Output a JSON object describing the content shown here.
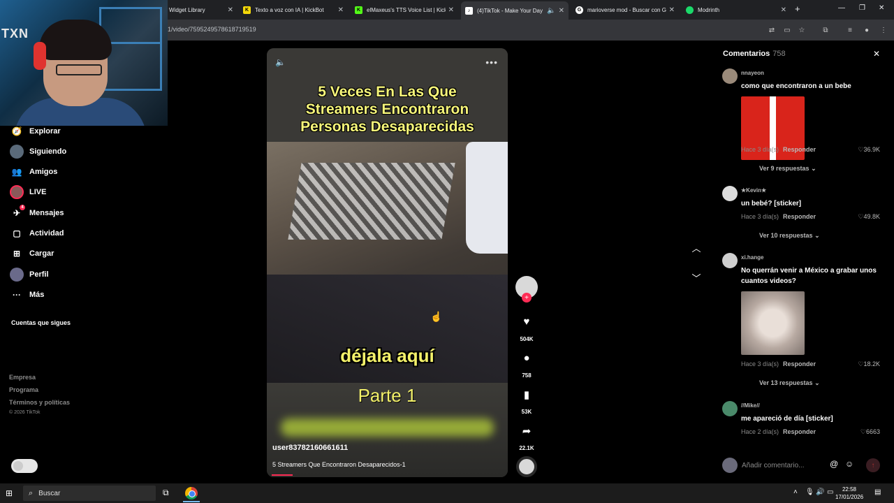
{
  "browser": {
    "tabs": [
      {
        "label": "Widget Library",
        "favicon_color": "#202124"
      },
      {
        "label": "Texto a voz con IA | KickBot",
        "favicon_color": "#f5d90a"
      },
      {
        "label": "elMaxeus's TTS Voice List | Kick",
        "favicon_color": "#53fc18"
      },
      {
        "label": "(4)TikTok - Make Your Day",
        "favicon_color": "#ffffff"
      },
      {
        "label": "marioverse mod - Buscar con G",
        "favicon_color": "#ffffff"
      },
      {
        "label": "Modrinth",
        "favicon_color": "#1bd96a"
      }
    ],
    "url": "1/video/7595249578618719519"
  },
  "webcam": {
    "logo_text": "TXN"
  },
  "sidebar": {
    "items": [
      {
        "label": "Explorar",
        "icon": "compass-icon"
      },
      {
        "label": "Siguiendo",
        "icon": "following-avatar-icon"
      },
      {
        "label": "Amigos",
        "icon": "friends-icon"
      },
      {
        "label": "LIVE",
        "icon": "live-avatar-icon"
      },
      {
        "label": "Mensajes",
        "icon": "messages-icon",
        "badge": "4"
      },
      {
        "label": "Actividad",
        "icon": "activity-icon"
      },
      {
        "label": "Cargar",
        "icon": "upload-icon"
      },
      {
        "label": "Perfil",
        "icon": "profile-avatar-icon"
      },
      {
        "label": "Más",
        "icon": "more-dots-icon"
      }
    ],
    "following_title": "Cuentas que sigues",
    "footer_links": [
      "Empresa",
      "Programa",
      "Términos y políticas"
    ],
    "copyright": "© 2026 TikTok"
  },
  "video": {
    "title_lines": [
      "5 Veces En Las Que",
      "Streamers Encontraron",
      "Personas Desaparecidas"
    ],
    "caption": "déjala aquí",
    "part": "Parte 1",
    "username": "user83782160661611",
    "description": "5 Streamers Que Encontraron Desaparecidos-1"
  },
  "actions": {
    "likes": "504K",
    "comments": "758",
    "saves": "53K",
    "shares": "22.1K"
  },
  "comments": {
    "title": "Comentarios",
    "count": "758",
    "reply_label": "Responder",
    "input_placeholder": "Añadir comentario...",
    "items": [
      {
        "user": "nnayeon",
        "text": "como que encontraron a un bebe",
        "meta": "Hace 3 día(s)",
        "likes": "36.9K",
        "more": "Ver 9 respuestas"
      },
      {
        "user": "★Kevin★",
        "text": "un bebé? [sticker]",
        "meta": "Hace 3 día(s)",
        "likes": "49.8K",
        "more": "Ver 10 respuestas"
      },
      {
        "user": "xi.hange",
        "text": "No querrán venir a México a grabar unos cuantos videos?",
        "meta": "Hace 3 día(s)",
        "likes": "18.2K",
        "more": "Ver 13 respuestas"
      },
      {
        "user": "//Mike//",
        "text": "me apareció de día [sticker]",
        "meta": "Hace 2 día(s)",
        "likes": "6663",
        "more": ""
      }
    ]
  },
  "taskbar": {
    "search_label": "Buscar",
    "time": "22:58",
    "date": "17/01/2026"
  }
}
